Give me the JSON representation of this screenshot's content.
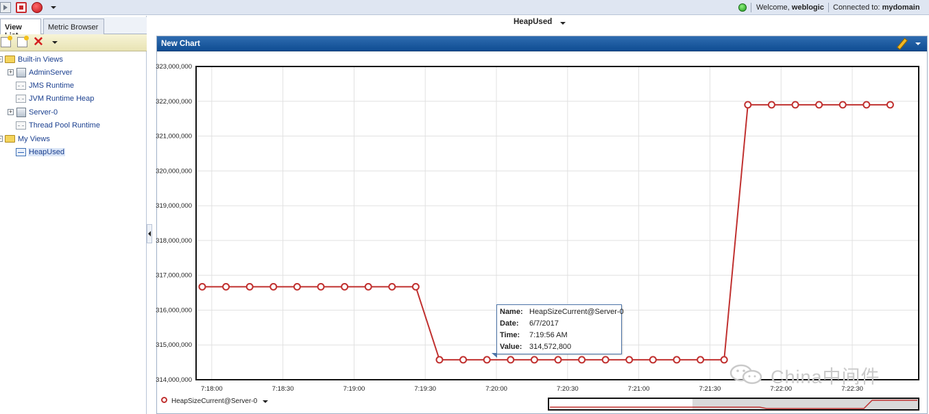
{
  "topbar": {
    "welcome_label": "Welcome,",
    "user": "weblogic",
    "connected_label": "Connected to:",
    "domain": "mydomain",
    "status_color": "#2aa82a"
  },
  "left": {
    "tabs": [
      {
        "label": "View List",
        "active": true
      },
      {
        "label": "Metric Browser",
        "active": false
      }
    ],
    "tree": {
      "builtin": "Built-in Views",
      "admin": "AdminServer",
      "jms": "JMS Runtime",
      "jvm": "JVM Runtime Heap",
      "server0": "Server-0",
      "thread": "Thread Pool Runtime",
      "myviews": "My Views",
      "heapused": "HeapUsed"
    }
  },
  "main": {
    "view_title": "HeapUsed",
    "chart_panel_title": "New Chart",
    "legend": "HeapSizeCurrent@Server-0",
    "series_color": "#c0302f",
    "tooltip": {
      "name_label": "Name:",
      "name": "HeapSizeCurrent@Server-0",
      "date_label": "Date:",
      "date": "6/7/2017",
      "time_label": "Time:",
      "time": "7:19:56 AM",
      "value_label": "Value:",
      "value": "314,572,800"
    }
  },
  "watermark": {
    "text": "China中间件",
    "icon": "wechat-icon"
  },
  "chart_data": {
    "type": "line",
    "ylim": [
      314000000,
      323000000
    ],
    "yticks": [
      314000000,
      315000000,
      316000000,
      317000000,
      318000000,
      319000000,
      320000000,
      321000000,
      322000000,
      323000000
    ],
    "ytick_labels": [
      "314,000,000",
      "315,000,000",
      "316,000,000",
      "317,000,000",
      "318,000,000",
      "319,000,000",
      "320,000,000",
      "321,000,000",
      "322,000,000",
      "323,000,000"
    ],
    "xtick_labels": [
      "7:18:00",
      "7:18:30",
      "7:19:00",
      "7:19:30",
      "7:20:00",
      "7:20:30",
      "7:21:00",
      "7:21:30",
      "7:22:00",
      "7:22:30"
    ],
    "x_seconds_start": "7:17:56",
    "x_step_seconds": 10,
    "grid": true,
    "legend_position": "bottom-left",
    "series": [
      {
        "name": "HeapSizeCurrent@Server-0",
        "values": [
          316670000,
          316670000,
          316670000,
          316670000,
          316670000,
          316670000,
          316670000,
          316670000,
          316670000,
          316670000,
          314572800,
          314572800,
          314572800,
          314572800,
          314572800,
          314572800,
          314572800,
          314572800,
          314572800,
          314572800,
          314572800,
          314572800,
          314572800,
          321900000,
          321900000,
          321900000,
          321900000,
          321900000,
          321900000,
          321900000
        ]
      }
    ]
  }
}
